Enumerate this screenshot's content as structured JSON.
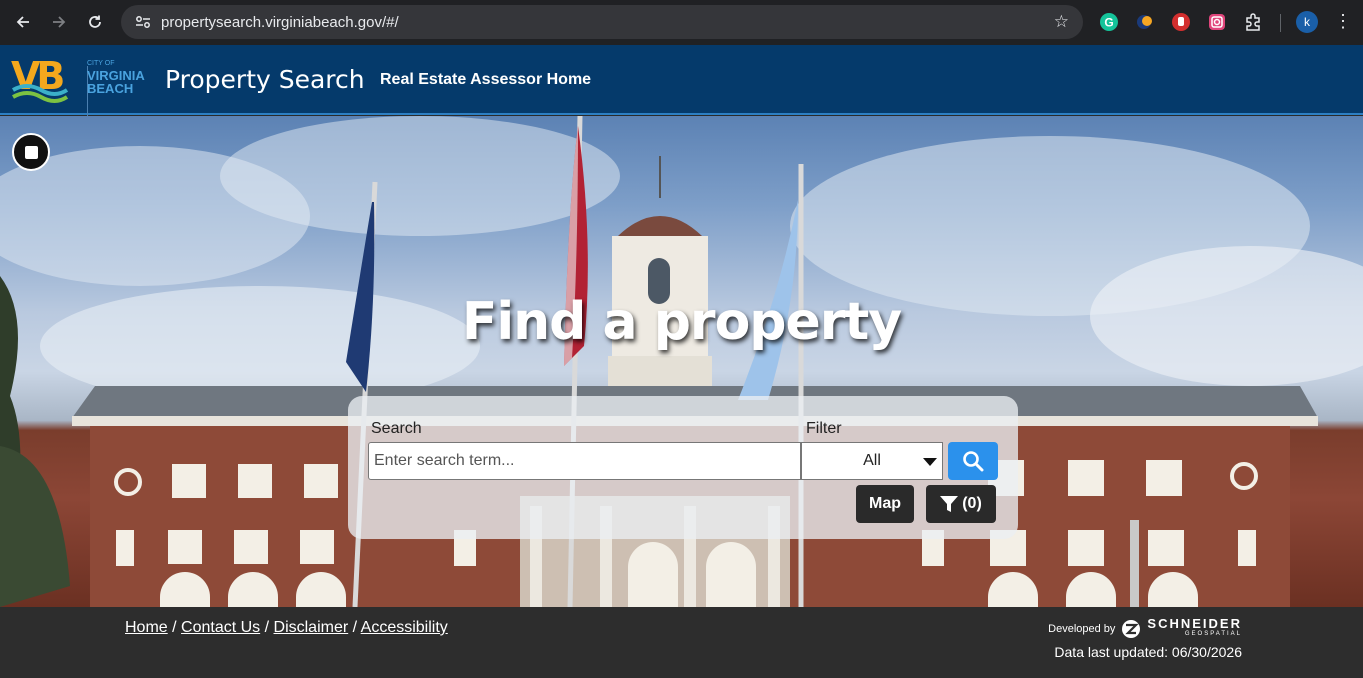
{
  "browser": {
    "url": "propertysearch.virginiabeach.gov/#/",
    "profile_initial": "k"
  },
  "header": {
    "logo_vb": "VB",
    "logo_city_of": "CITY OF",
    "logo_city_name_1": "VIRGINIA",
    "logo_city_name_2": "BEACH",
    "site_title": "Property Search",
    "nav_link": "Real Estate Assessor Home"
  },
  "hero": {
    "title": "Find a property"
  },
  "search": {
    "search_label": "Search",
    "placeholder": "Enter search term...",
    "filter_label": "Filter",
    "filter_value": "All",
    "map_label": "Map",
    "filter_count": "(0)"
  },
  "footer": {
    "links": [
      "Home",
      "Contact Us",
      "Disclaimer",
      "Accessibility"
    ],
    "separator": " / ",
    "developed_by": "Developed by",
    "brand": "SCHNEIDER",
    "brand_sub": "GEOSPATIAL",
    "updated": "Data last updated: 06/30/2026"
  },
  "colors": {
    "header_bg": "#053a6b",
    "search_button": "#2b91ec",
    "footer_bg": "#2d2d2d"
  }
}
